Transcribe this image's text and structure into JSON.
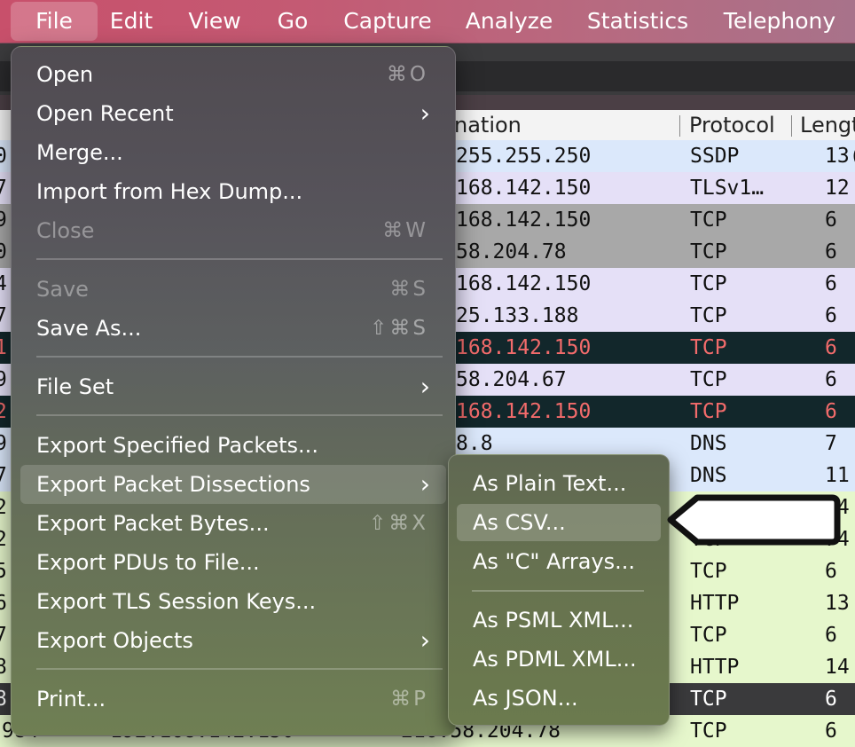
{
  "menubar": {
    "items": [
      "File",
      "Edit",
      "View",
      "Go",
      "Capture",
      "Analyze",
      "Statistics",
      "Telephony"
    ]
  },
  "packet_list": {
    "columns": [
      "nation",
      "Protocol",
      "Lengt"
    ],
    "rows": [
      {
        "lead": "0",
        "dest": "255.255.250",
        "proto": "SSDP",
        "len": "13(",
        "bg": "#dbe8fb",
        "color": "#111"
      },
      {
        "lead": "7",
        "dest": "168.142.150",
        "proto": "TLSv1…",
        "len": "12",
        "bg": "#e5e0f7",
        "color": "#111"
      },
      {
        "lead": "9",
        "dest": "168.142.150",
        "proto": "TCP",
        "len": "6",
        "bg": "#a8a8a8",
        "color": "#111"
      },
      {
        "lead": "0",
        "dest": "58.204.78",
        "proto": "TCP",
        "len": "6",
        "bg": "#a8a8a8",
        "color": "#111"
      },
      {
        "lead": "4",
        "dest": "168.142.150",
        "proto": "TCP",
        "len": "6",
        "bg": "#e5e0f7",
        "color": "#111"
      },
      {
        "lead": "7",
        "dest": "25.133.188",
        "proto": "TCP",
        "len": "6",
        "bg": "#e5e0f7",
        "color": "#111"
      },
      {
        "lead": "1",
        "dest": "168.142.150",
        "proto": "TCP",
        "len": "6",
        "bg": "#12272b",
        "color": "#f26b6b"
      },
      {
        "lead": "9",
        "dest": "58.204.67",
        "proto": "TCP",
        "len": "6",
        "bg": "#e5e0f7",
        "color": "#111"
      },
      {
        "lead": "2",
        "dest": "168.142.150",
        "proto": "TCP",
        "len": "6",
        "bg": "#12272b",
        "color": "#f26b6b"
      },
      {
        "lead": "9",
        "dest": "8.8",
        "proto": "DNS",
        "len": "7",
        "bg": "#dbe8fb",
        "color": "#111"
      },
      {
        "lead": "7",
        "dest": "",
        "proto": "DNS",
        "len": "11",
        "bg": "#dbe8fb",
        "color": "#111"
      },
      {
        "lead": "2",
        "dest": "",
        "proto": "",
        "len": "74",
        "bg": "#e6f7cc",
        "color": "#111"
      },
      {
        "lead": "2",
        "dest": "",
        "proto": "TCP",
        "len": "74",
        "bg": "#e6f7cc",
        "color": "#111"
      },
      {
        "lead": "5",
        "dest": "",
        "proto": "TCP",
        "len": "6",
        "bg": "#e6f7cc",
        "color": "#111"
      },
      {
        "lead": "6",
        "dest": "",
        "proto": "HTTP",
        "len": "13",
        "bg": "#e6f7cc",
        "color": "#111"
      },
      {
        "lead": "7",
        "dest": "",
        "proto": "TCP",
        "len": "6",
        "bg": "#e6f7cc",
        "color": "#111"
      },
      {
        "lead": "8",
        "dest": "",
        "proto": "HTTP",
        "len": "14",
        "bg": "#e6f7cc",
        "color": "#111"
      },
      {
        "lead": "8",
        "dest": "",
        "proto": "TCP",
        "len": "6",
        "bg": "#3a3a3c",
        "color": "#ffffff"
      },
      {
        "lead": "984",
        "dest": "192.168.142.150",
        "proto": "TCP",
        "len": "6",
        "bg": "#e6f7cc",
        "color": "#111",
        "extra": "216.58.204.78"
      }
    ]
  },
  "file_menu": {
    "open": {
      "label": "Open",
      "shortcut": "⌘O"
    },
    "open_recent": {
      "label": "Open Recent"
    },
    "merge": {
      "label": "Merge..."
    },
    "import_hex": {
      "label": "Import from Hex Dump..."
    },
    "close": {
      "label": "Close",
      "shortcut": "⌘W"
    },
    "save": {
      "label": "Save",
      "shortcut": "⌘S"
    },
    "save_as": {
      "label": "Save As...",
      "shortcut": "⇧⌘S"
    },
    "file_set": {
      "label": "File Set"
    },
    "export_specified": {
      "label": "Export Specified Packets..."
    },
    "export_dissections": {
      "label": "Export Packet Dissections"
    },
    "export_bytes": {
      "label": "Export Packet Bytes...",
      "shortcut": "⇧⌘X"
    },
    "export_pdus": {
      "label": "Export PDUs to File..."
    },
    "export_tls": {
      "label": "Export TLS Session Keys..."
    },
    "export_objects": {
      "label": "Export Objects"
    },
    "print": {
      "label": "Print...",
      "shortcut": "⌘P"
    }
  },
  "submenu": {
    "plain_text": "As Plain Text...",
    "csv": "As CSV...",
    "c_arrays": "As \"C\" Arrays...",
    "psml": "As PSML XML...",
    "pdml": "As PDML XML...",
    "json": "As JSON..."
  },
  "icons": {
    "submenu_arrow": "chevron-right-icon",
    "callout": "callout-arrow"
  },
  "colors": {
    "menubar_accent": "#c8506b",
    "highlight": "rgba(255,255,255,0.16)"
  }
}
